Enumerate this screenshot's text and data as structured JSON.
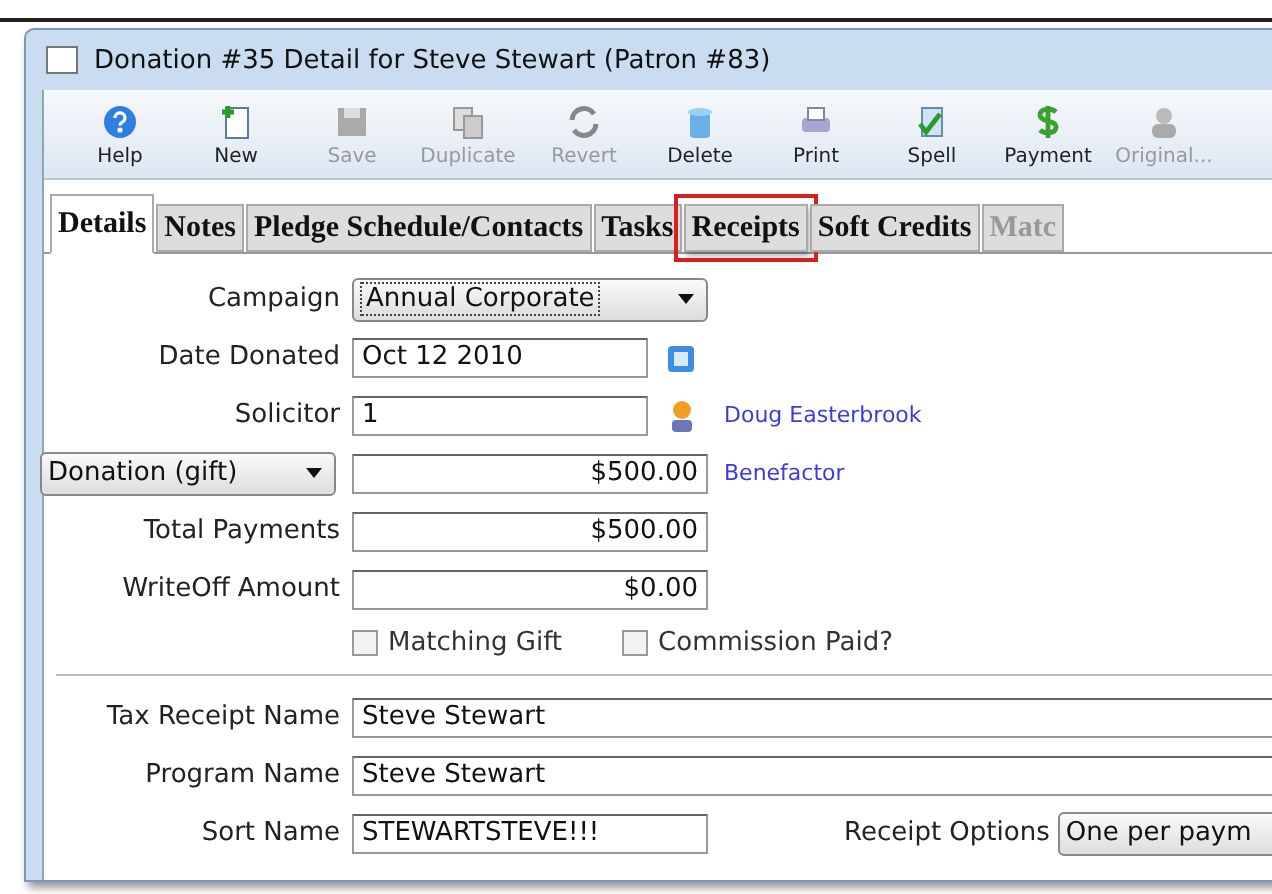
{
  "window": {
    "title": "Donation #35 Detail for Steve Stewart (Patron #83)"
  },
  "toolbar": [
    {
      "label": "Help",
      "kind": "help",
      "disabled": false
    },
    {
      "label": "New",
      "kind": "new",
      "disabled": false
    },
    {
      "label": "Save",
      "kind": "save",
      "disabled": true
    },
    {
      "label": "Duplicate",
      "kind": "duplicate",
      "disabled": true
    },
    {
      "label": "Revert",
      "kind": "revert",
      "disabled": true
    },
    {
      "label": "Delete",
      "kind": "delete",
      "disabled": false
    },
    {
      "label": "Print",
      "kind": "print",
      "disabled": false
    },
    {
      "label": "Spell",
      "kind": "spell",
      "disabled": false
    },
    {
      "label": "Payment",
      "kind": "payment",
      "disabled": false
    },
    {
      "label": "Original...",
      "kind": "original",
      "disabled": true
    }
  ],
  "tabs": [
    {
      "label": "Details",
      "selected": true,
      "disabled": false,
      "highlighted": false
    },
    {
      "label": "Notes",
      "selected": false,
      "disabled": false,
      "highlighted": false
    },
    {
      "label": "Pledge Schedule/Contacts",
      "selected": false,
      "disabled": false,
      "highlighted": false
    },
    {
      "label": "Tasks",
      "selected": false,
      "disabled": false,
      "highlighted": false
    },
    {
      "label": "Receipts",
      "selected": false,
      "disabled": false,
      "highlighted": true
    },
    {
      "label": "Soft Credits",
      "selected": false,
      "disabled": false,
      "highlighted": false
    },
    {
      "label": "Matc",
      "selected": false,
      "disabled": true,
      "highlighted": false
    }
  ],
  "form": {
    "campaign": {
      "label": "Campaign",
      "value": "Annual Corporate"
    },
    "date_donated": {
      "label": "Date Donated",
      "value": "Oct 12 2010"
    },
    "solicitor": {
      "label": "Solicitor",
      "value": "1",
      "link": "Doug Easterbrook"
    },
    "type": {
      "value": "Donation (gift)",
      "amount": "$500.00",
      "link": "Benefactor"
    },
    "total_payments": {
      "label": "Total Payments",
      "value": "$500.00"
    },
    "writeoff_amount": {
      "label": "WriteOff Amount",
      "value": "$0.00"
    },
    "checkboxes": [
      {
        "label": "Matching Gift",
        "checked": false
      },
      {
        "label": "Commission Paid?",
        "checked": false
      }
    ],
    "tax_receipt_name": {
      "label": "Tax Receipt Name",
      "value": "Steve Stewart"
    },
    "program_name": {
      "label": "Program Name",
      "value": "Steve Stewart"
    },
    "sort_name": {
      "label": "Sort Name",
      "value": "STEWARTSTEVE!!!"
    },
    "receipt_options": {
      "label": "Receipt Options",
      "value": "One per paym"
    }
  }
}
